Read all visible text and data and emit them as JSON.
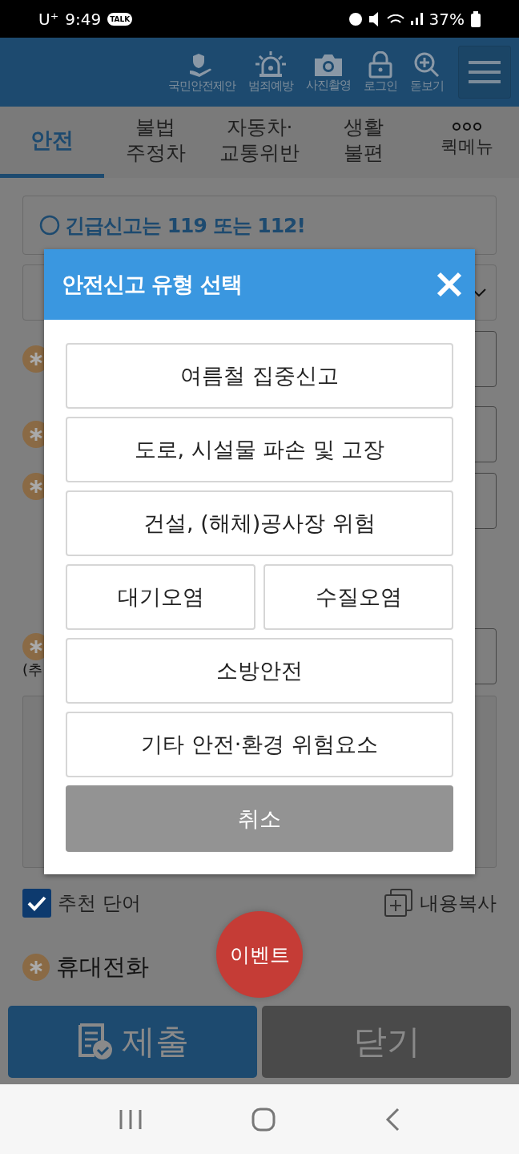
{
  "status_bar": {
    "carrier": "U⁺",
    "time": "9:49",
    "talk_badge": "TALK",
    "battery": "37%"
  },
  "header": {
    "items": [
      {
        "kind": "hand",
        "label": "국민안전제안"
      },
      {
        "kind": "siren",
        "label": "범죄예방"
      },
      {
        "kind": "camera",
        "label": "사진촬영"
      },
      {
        "kind": "lock",
        "label": "로그인"
      },
      {
        "kind": "zoom",
        "label": "돋보기"
      }
    ]
  },
  "tabs": [
    {
      "label": "안전",
      "selected": true
    },
    {
      "label": "불법\n주정차",
      "selected": false
    },
    {
      "label": "자동차·\n교통위반",
      "selected": false
    },
    {
      "label": "생활\n불편",
      "selected": false
    },
    {
      "label": "퀵메뉴",
      "selected": false
    }
  ],
  "notice": "긴급신고는 119 또는 112!",
  "form_fragments": {
    "note": "(추"
  },
  "recommend": {
    "label": "추천 단어",
    "checked": true,
    "copy": "내용복사"
  },
  "event_badge": "이벤트",
  "phone_label": "휴대전화",
  "bottom_buttons": {
    "submit": "제출",
    "close": "닫기"
  },
  "dialog": {
    "title": "안전신고 유형 선택",
    "options": [
      [
        "여름철 집중신고"
      ],
      [
        "도로, 시설물 파손 및 고장"
      ],
      [
        "건설, (해체)공사장 위험"
      ],
      [
        "대기오염",
        "수질오염"
      ],
      [
        "소방안전"
      ],
      [
        "기타 안전·환경 위험요소"
      ]
    ],
    "cancel": "취소"
  }
}
